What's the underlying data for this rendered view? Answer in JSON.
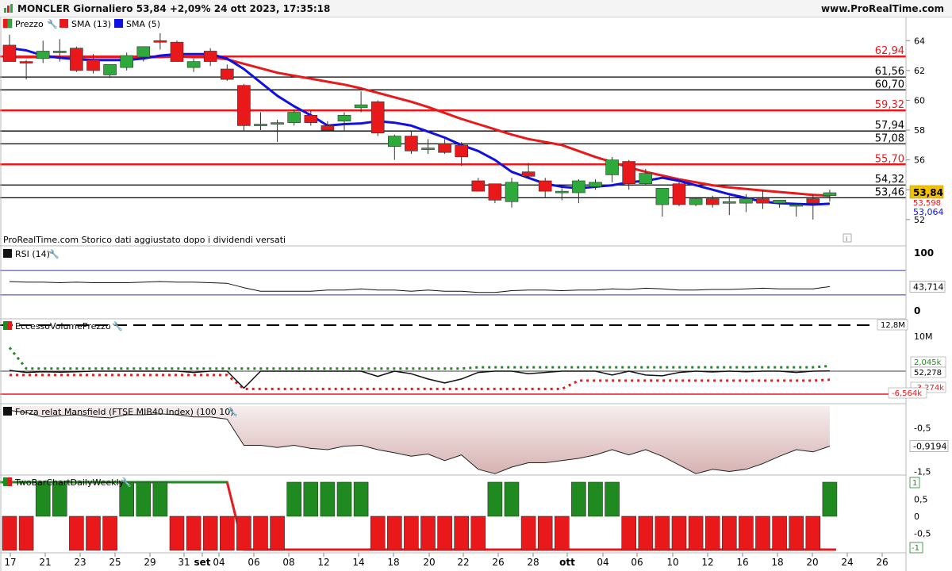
{
  "header": {
    "title": "MONCLER Giornaliero 53,84 +2,09% 24 ott 2023, 17:35:18",
    "site": "www.ProRealTime.com"
  },
  "colors": {
    "up": "#2eaa3c",
    "down": "#e8181b",
    "sma13": "#e8181b",
    "sma5": "#1010e0",
    "level_black": "#000000",
    "level_red": "#e8181b",
    "mansfield_fill": "#d7b2b2",
    "rsi_band": "#3030c0",
    "evp_green": "#1f8a1f",
    "evp_red": "#e8181b"
  },
  "price_panel": {
    "legend": [
      "Prezzo",
      "SMA (13)",
      "SMA (5)"
    ],
    "note": "ProRealTime.com  Storico dati aggiustato dopo i dividendi versati",
    "y_ticks": [
      "64",
      "62",
      "60",
      "58",
      "56",
      "54",
      "52"
    ],
    "level_labels": [
      {
        "text": "62,94",
        "value": 62.94,
        "color": "red"
      },
      {
        "text": "61,56",
        "value": 61.56,
        "color": "black"
      },
      {
        "text": "60,70",
        "value": 60.7,
        "color": "black"
      },
      {
        "text": "59,32",
        "value": 59.32,
        "color": "red"
      },
      {
        "text": "57,94",
        "value": 57.94,
        "color": "black"
      },
      {
        "text": "57,08",
        "value": 57.08,
        "color": "black"
      },
      {
        "text": "55,70",
        "value": 55.7,
        "color": "red"
      },
      {
        "text": "54,32",
        "value": 54.32,
        "color": "black"
      },
      {
        "text": "53,46",
        "value": 53.46,
        "color": "black"
      }
    ],
    "last_price": "53,84",
    "sma13_value": "53,598",
    "sma5_value": "53,064"
  },
  "rsi_panel": {
    "legend": "RSI (14)",
    "y_ticks": [
      "100",
      "0"
    ],
    "value": "43,714"
  },
  "evp_panel": {
    "legend": "EccessoVolumePrezzo",
    "y_ticks": [
      "10M",
      "0"
    ],
    "labels": [
      "12,8M",
      "2,045k",
      "52,278",
      "-3,274k",
      "-6,564k"
    ]
  },
  "mansfield_panel": {
    "legend": "Forza relat Mansfield (FTSE MIB40 Index) (100 10)",
    "y_ticks": [
      "-0,5",
      "-1,5"
    ],
    "value": "-0,9194"
  },
  "twobar_panel": {
    "legend": "TwoBarChartDailyWeekly",
    "y_ticks": [
      "0,5",
      "0",
      "-0,5"
    ],
    "labels": [
      "1",
      "-1"
    ]
  },
  "x_axis": {
    "ticks": [
      "17",
      "21",
      "23",
      "25",
      "29",
      "31",
      "set",
      "04",
      "06",
      "08",
      "12",
      "14",
      "18",
      "20",
      "22",
      "26",
      "28",
      "ott",
      "04",
      "06",
      "10",
      "12",
      "16",
      "18",
      "20",
      "24",
      "26"
    ]
  },
  "chart_data": {
    "type": "candlestick",
    "title": "MONCLER Giornaliero",
    "ylim": [
      51.3,
      64.6
    ],
    "candles": [
      [
        63.7,
        64.4,
        62.6,
        62.6
      ],
      [
        62.6,
        62.7,
        61.4,
        62.5
      ],
      [
        62.8,
        64.0,
        62.5,
        63.3
      ],
      [
        63.2,
        64.1,
        62.6,
        63.3
      ],
      [
        63.5,
        63.6,
        61.9,
        62.0
      ],
      [
        62.7,
        63.1,
        61.8,
        62.0
      ],
      [
        61.7,
        62.4,
        61.5,
        62.4
      ],
      [
        62.2,
        63.2,
        62.0,
        63.0
      ],
      [
        62.9,
        63.6,
        62.6,
        63.6
      ],
      [
        64.0,
        64.5,
        63.4,
        63.9
      ],
      [
        63.9,
        64.0,
        62.6,
        62.6
      ],
      [
        62.2,
        62.8,
        61.9,
        62.6
      ],
      [
        63.3,
        63.5,
        62.3,
        62.6
      ],
      [
        62.1,
        62.4,
        61.3,
        61.4
      ],
      [
        61.0,
        61.1,
        57.9,
        58.3
      ],
      [
        58.4,
        59.2,
        58.0,
        58.4
      ],
      [
        58.4,
        58.7,
        57.2,
        58.5
      ],
      [
        58.5,
        59.4,
        58.3,
        59.2
      ],
      [
        59.0,
        59.3,
        58.3,
        58.5
      ],
      [
        58.3,
        58.6,
        57.9,
        58.0
      ],
      [
        58.6,
        59.2,
        57.9,
        59.0
      ],
      [
        59.5,
        60.6,
        59.2,
        59.7
      ],
      [
        59.9,
        60.0,
        57.6,
        57.8
      ],
      [
        56.9,
        57.7,
        56.0,
        57.6
      ],
      [
        57.6,
        57.9,
        56.4,
        56.6
      ],
      [
        56.7,
        57.4,
        56.4,
        56.8
      ],
      [
        57.1,
        57.4,
        56.4,
        56.5
      ],
      [
        57.0,
        57.2,
        55.6,
        56.2
      ],
      [
        54.6,
        54.8,
        54.0,
        53.9
      ],
      [
        54.4,
        54.4,
        53.1,
        53.3
      ],
      [
        53.2,
        54.8,
        52.8,
        54.5
      ],
      [
        55.2,
        55.8,
        54.8,
        54.9
      ],
      [
        54.6,
        54.8,
        53.5,
        53.9
      ],
      [
        53.8,
        54.1,
        53.3,
        53.9
      ],
      [
        53.8,
        54.7,
        53.1,
        54.6
      ],
      [
        54.2,
        54.7,
        54.0,
        54.5
      ],
      [
        55.0,
        56.2,
        54.5,
        56.0
      ],
      [
        55.9,
        56.0,
        54.0,
        54.4
      ],
      [
        54.4,
        55.4,
        54.3,
        55.1
      ],
      [
        53.0,
        53.8,
        52.2,
        54.1
      ],
      [
        54.4,
        54.5,
        52.9,
        53.0
      ],
      [
        53.0,
        53.5,
        52.9,
        53.4
      ],
      [
        53.4,
        53.6,
        52.8,
        53.0
      ],
      [
        53.1,
        53.6,
        52.3,
        53.2
      ],
      [
        53.1,
        53.7,
        52.5,
        53.4
      ],
      [
        53.4,
        54.0,
        52.7,
        53.1
      ],
      [
        53.1,
        53.3,
        52.8,
        53.3
      ],
      [
        53.0,
        53.1,
        52.2,
        53.0
      ],
      [
        53.4,
        53.7,
        52.0,
        53.1
      ],
      [
        53.6,
        54.0,
        53.2,
        53.8
      ]
    ],
    "sma13": [
      62.9,
      62.9,
      62.9,
      62.9,
      62.9,
      62.9,
      62.9,
      62.9,
      62.9,
      62.9,
      62.95,
      62.9,
      62.9,
      62.75,
      62.45,
      62.15,
      61.85,
      61.65,
      61.45,
      61.25,
      61.05,
      60.8,
      60.5,
      60.2,
      59.9,
      59.55,
      59.15,
      58.75,
      58.4,
      58.05,
      57.7,
      57.4,
      57.2,
      57.0,
      56.6,
      56.2,
      55.85,
      55.5,
      55.2,
      54.95,
      54.7,
      54.5,
      54.3,
      54.15,
      54.05,
      53.95,
      53.85,
      53.75,
      53.65,
      53.6
    ],
    "sma5": [
      63.5,
      63.35,
      63.0,
      62.85,
      62.75,
      62.7,
      62.7,
      62.7,
      62.8,
      63.0,
      63.1,
      63.1,
      63.1,
      62.8,
      62.1,
      61.2,
      60.3,
      59.6,
      59.0,
      58.3,
      58.4,
      58.45,
      58.6,
      58.5,
      58.3,
      57.9,
      57.5,
      57.0,
      56.6,
      56.0,
      55.2,
      54.8,
      54.4,
      54.2,
      54.1,
      54.2,
      54.3,
      54.5,
      54.6,
      54.8,
      54.6,
      54.3,
      54.0,
      53.7,
      53.45,
      53.2,
      53.1,
      53.05,
      53.0,
      53.06
    ],
    "levels": [
      62.94,
      61.56,
      60.7,
      59.32,
      57.94,
      57.08,
      55.7,
      54.32,
      53.46
    ],
    "rsi": [
      52,
      51,
      51,
      50,
      51,
      50,
      50,
      50,
      51,
      52,
      51,
      51,
      50,
      49,
      42,
      36,
      36,
      36,
      36,
      38,
      38,
      40,
      38,
      38,
      36,
      38,
      36,
      36,
      34,
      34,
      37,
      38,
      38,
      37,
      38,
      38,
      40,
      39,
      41,
      40,
      38,
      38,
      39,
      39,
      40,
      41,
      40,
      40,
      40,
      43.7
    ],
    "evp": [
      0.3,
      -0.5,
      -0.2,
      -0.4,
      -0.2,
      0.0,
      0.0,
      0.0,
      0.0,
      0.0,
      0.0,
      -0.5,
      0.0,
      0.0,
      -6.5,
      0.0,
      0.0,
      0.0,
      0.0,
      0.0,
      0.0,
      0.0,
      -2.0,
      0.0,
      -1.0,
      -3.0,
      -4.5,
      -3.0,
      -0.5,
      0.0,
      0.0,
      -1.0,
      -0.5,
      0.0,
      0.0,
      0.0,
      -1.5,
      0.0,
      -1.5,
      -1.8,
      -0.5,
      0.0,
      -0.3,
      0.0,
      -0.2,
      0.0,
      0.0,
      -0.5,
      0.0,
      0.05
    ],
    "evp_upper": [
      9.0,
      1.0,
      1.0,
      1.0,
      1.0,
      1.0,
      1.0,
      1.0,
      1.0,
      1.0,
      1.0,
      1.0,
      1.0,
      1.0,
      1.0,
      1.0,
      1.0,
      1.0,
      1.0,
      1.0,
      1.0,
      1.0,
      1.0,
      1.0,
      1.0,
      1.0,
      1.0,
      1.0,
      1.5,
      1.5,
      1.5,
      1.5,
      1.5,
      1.5,
      1.5,
      1.5,
      1.5,
      1.5,
      1.5,
      1.5,
      1.5,
      1.5,
      1.5,
      1.5,
      1.5,
      1.5,
      1.5,
      1.5,
      1.5,
      2.0
    ],
    "evp_lower": [
      -1.5,
      -1.5,
      -1.5,
      -1.5,
      -1.5,
      -1.5,
      -1.5,
      -1.5,
      -1.5,
      -1.5,
      -1.5,
      -1.5,
      -1.5,
      -1.5,
      -6.8,
      -6.8,
      -6.8,
      -6.8,
      -6.8,
      -6.8,
      -6.8,
      -6.8,
      -6.8,
      -6.8,
      -6.8,
      -6.8,
      -6.8,
      -6.8,
      -6.8,
      -6.8,
      -6.8,
      -6.8,
      -6.8,
      -6.8,
      -3.6,
      -3.6,
      -3.6,
      -3.6,
      -3.6,
      -3.6,
      -3.6,
      -3.6,
      -3.6,
      -3.6,
      -3.6,
      -3.6,
      -3.6,
      -3.6,
      -3.6,
      -3.27
    ],
    "mansfield": [
      -0.1,
      -0.15,
      -0.25,
      -0.22,
      -0.2,
      -0.25,
      -0.27,
      -0.2,
      -0.2,
      -0.18,
      -0.2,
      -0.25,
      -0.25,
      -0.3,
      -0.9,
      -0.9,
      -0.95,
      -0.9,
      -0.97,
      -1.0,
      -0.92,
      -0.9,
      -1.0,
      -1.07,
      -1.15,
      -1.1,
      -1.25,
      -1.12,
      -1.45,
      -1.55,
      -1.4,
      -1.3,
      -1.3,
      -1.25,
      -1.2,
      -1.12,
      -1.0,
      -1.12,
      -1.0,
      -1.15,
      -1.35,
      -1.55,
      -1.45,
      -1.5,
      -1.45,
      -1.32,
      -1.15,
      -1.0,
      -1.05,
      -0.92
    ],
    "twobar": [
      -1,
      -1,
      1,
      1,
      -1,
      -1,
      -1,
      1,
      1,
      1,
      -1,
      -1,
      -1,
      -1,
      -1,
      -1,
      -1,
      1,
      1,
      1,
      1,
      1,
      -1,
      -1,
      -1,
      -1,
      -1,
      -1,
      -1,
      1,
      1,
      -1,
      -1,
      -1,
      1,
      1,
      1,
      -1,
      -1,
      -1,
      -1,
      -1,
      -1,
      -1,
      -1,
      -1,
      -1,
      -1,
      -1,
      1
    ],
    "twobar_weekly": [
      1,
      1,
      1,
      1,
      1,
      1,
      1,
      1,
      1,
      1,
      1,
      1,
      1,
      1,
      -1,
      -1,
      -1,
      -1,
      -1,
      -1,
      -1,
      -1,
      -1,
      -1,
      -1,
      -1,
      -1,
      -1,
      -1,
      -1,
      -1,
      -1,
      -1,
      -1,
      -1,
      -1,
      -1,
      -1,
      -1,
      -1,
      -1,
      -1,
      -1,
      -1,
      -1,
      -1,
      -1,
      -1,
      -1,
      -1
    ]
  }
}
